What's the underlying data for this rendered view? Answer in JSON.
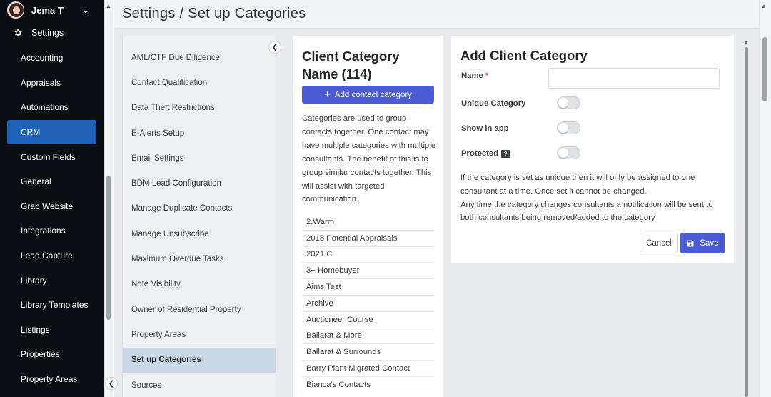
{
  "user": {
    "name": "Jema T",
    "menu_icon": "chevron-down-icon"
  },
  "settings_label": "Settings",
  "nav": {
    "items": [
      {
        "label": "Accounting"
      },
      {
        "label": "Appraisals"
      },
      {
        "label": "Automations"
      },
      {
        "label": "CRM",
        "active": true
      },
      {
        "label": "Custom Fields"
      },
      {
        "label": "General"
      },
      {
        "label": "Grab Website"
      },
      {
        "label": "Integrations"
      },
      {
        "label": "Lead Capture"
      },
      {
        "label": "Library"
      },
      {
        "label": "Library Templates"
      },
      {
        "label": "Listings"
      },
      {
        "label": "Properties"
      },
      {
        "label": "Property Areas"
      }
    ]
  },
  "page": {
    "title": "Settings / Set up Categories"
  },
  "subnav": {
    "items": [
      {
        "label": "AML/CTF Due Diligence"
      },
      {
        "label": "Contact Qualification"
      },
      {
        "label": "Data Theft Restrictions"
      },
      {
        "label": "E-Alerts Setup"
      },
      {
        "label": "Email Settings"
      },
      {
        "label": "BDM Lead Configuration"
      },
      {
        "label": "Manage Duplicate Contacts"
      },
      {
        "label": "Manage Unsubscribe"
      },
      {
        "label": "Maximum Overdue Tasks"
      },
      {
        "label": "Note Visibility"
      },
      {
        "label": "Owner of Residential Property"
      },
      {
        "label": "Property Areas"
      },
      {
        "label": "Set up Categories",
        "active": true
      },
      {
        "label": "Sources"
      }
    ]
  },
  "categories": {
    "title": "Client Category Name (114)",
    "add_button": "Add contact category",
    "description": "Categories are used to group contacts together. One contact may have multiple categories with multiple consultants. The benefit of this is to group similar contacts together. This will assist with targeted communication.",
    "list": [
      "2.Warm",
      "2018 Potential Appraisals",
      "2021 C",
      "3+ Homebuyer",
      "Aims Test",
      "Archive",
      "Auctioneer Course",
      "Ballarat & More",
      "Ballarat & Surrounds",
      "Barry Plant Migrated Contact",
      "Bianca's Contacts"
    ]
  },
  "form": {
    "title": "Add Client Category",
    "name_label": "Name",
    "name_required_mark": "*",
    "name_value": "",
    "unique_label": "Unique Category",
    "unique_on": false,
    "show_in_app_label": "Show in app",
    "show_in_app_on": false,
    "protected_label": "Protected",
    "protected_help_glyph": "?",
    "protected_on": false,
    "help_text_1": "If the category is set as unique then it will only be assigned to one consultant at a time. Once set it cannot be changed.",
    "help_text_2": "Any time the category changes consultants a notification will be sent to both consultants being removed/added to the category",
    "cancel_label": "Cancel",
    "save_label": "Save"
  },
  "colors": {
    "nav_bg": "#0b0f14",
    "nav_active": "#1e63b8",
    "primary_button": "#4a5bd4",
    "subnav_active": "#c9d8e6"
  }
}
